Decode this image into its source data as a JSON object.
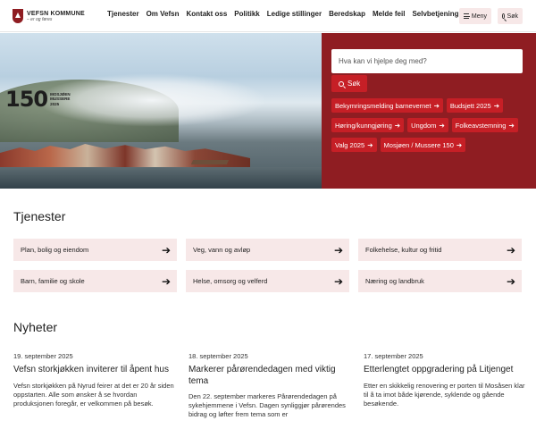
{
  "header": {
    "logo_name": "VEFSN KOMMUNE",
    "logo_tagline": "– er og føres",
    "nav": [
      "Tjenester",
      "Om Vefsn",
      "Kontakt oss",
      "Politikk",
      "Ledige stillinger",
      "Beredskap",
      "Melde feil",
      "Selvbetjening"
    ],
    "menu_label": "Meny",
    "search_label": "Søk"
  },
  "hero": {
    "badge_number": "150",
    "badge_lines": [
      "MOSJØEN",
      "MUSSERE",
      "2025"
    ],
    "search_placeholder": "Hva kan vi hjelpe deg med?",
    "search_button": "Søk",
    "quick_links": [
      "Bekymringsmelding barnevernet",
      "Budsjett 2025",
      "Høring/kunngjøring",
      "Ungdom",
      "Folkeavstemning",
      "Valg 2025",
      "Mosjøen / Mussere 150"
    ],
    "accent_color": "#8f1d22",
    "button_color": "#c61f26"
  },
  "services": {
    "title": "Tjenester",
    "items": [
      "Plan, bolig og eiendom",
      "Veg, vann og avløp",
      "Folkehelse, kultur og fritid",
      "Barn, familie og skole",
      "Helse, omsorg og velferd",
      "Næring og landbruk"
    ]
  },
  "news": {
    "title": "Nyheter",
    "items": [
      {
        "date": "19. september 2025",
        "title": "Vefsn storkjøkken inviterer til åpent hus",
        "body": "Vefsn storkjøkken på Nyrud feirer at det er 20 år siden oppstarten. Alle som ønsker å se hvordan produksjonen foregår, er velkommen på besøk."
      },
      {
        "date": "18. september 2025",
        "title": "Markerer pårørendedagen med viktig tema",
        "body": "Den 22. september markeres Pårørendedagen på sykehjemmene i Vefsn. Dagen synliggjør pårørendes bidrag og løfter frem tema som er"
      },
      {
        "date": "17. september 2025",
        "title": "Etterlengtet oppgradering på Litjenget",
        "body": "Etter en skikkelig renovering er porten til Mosåsen klar til å ta imot både kjørende, syklende og gående besøkende."
      }
    ]
  }
}
